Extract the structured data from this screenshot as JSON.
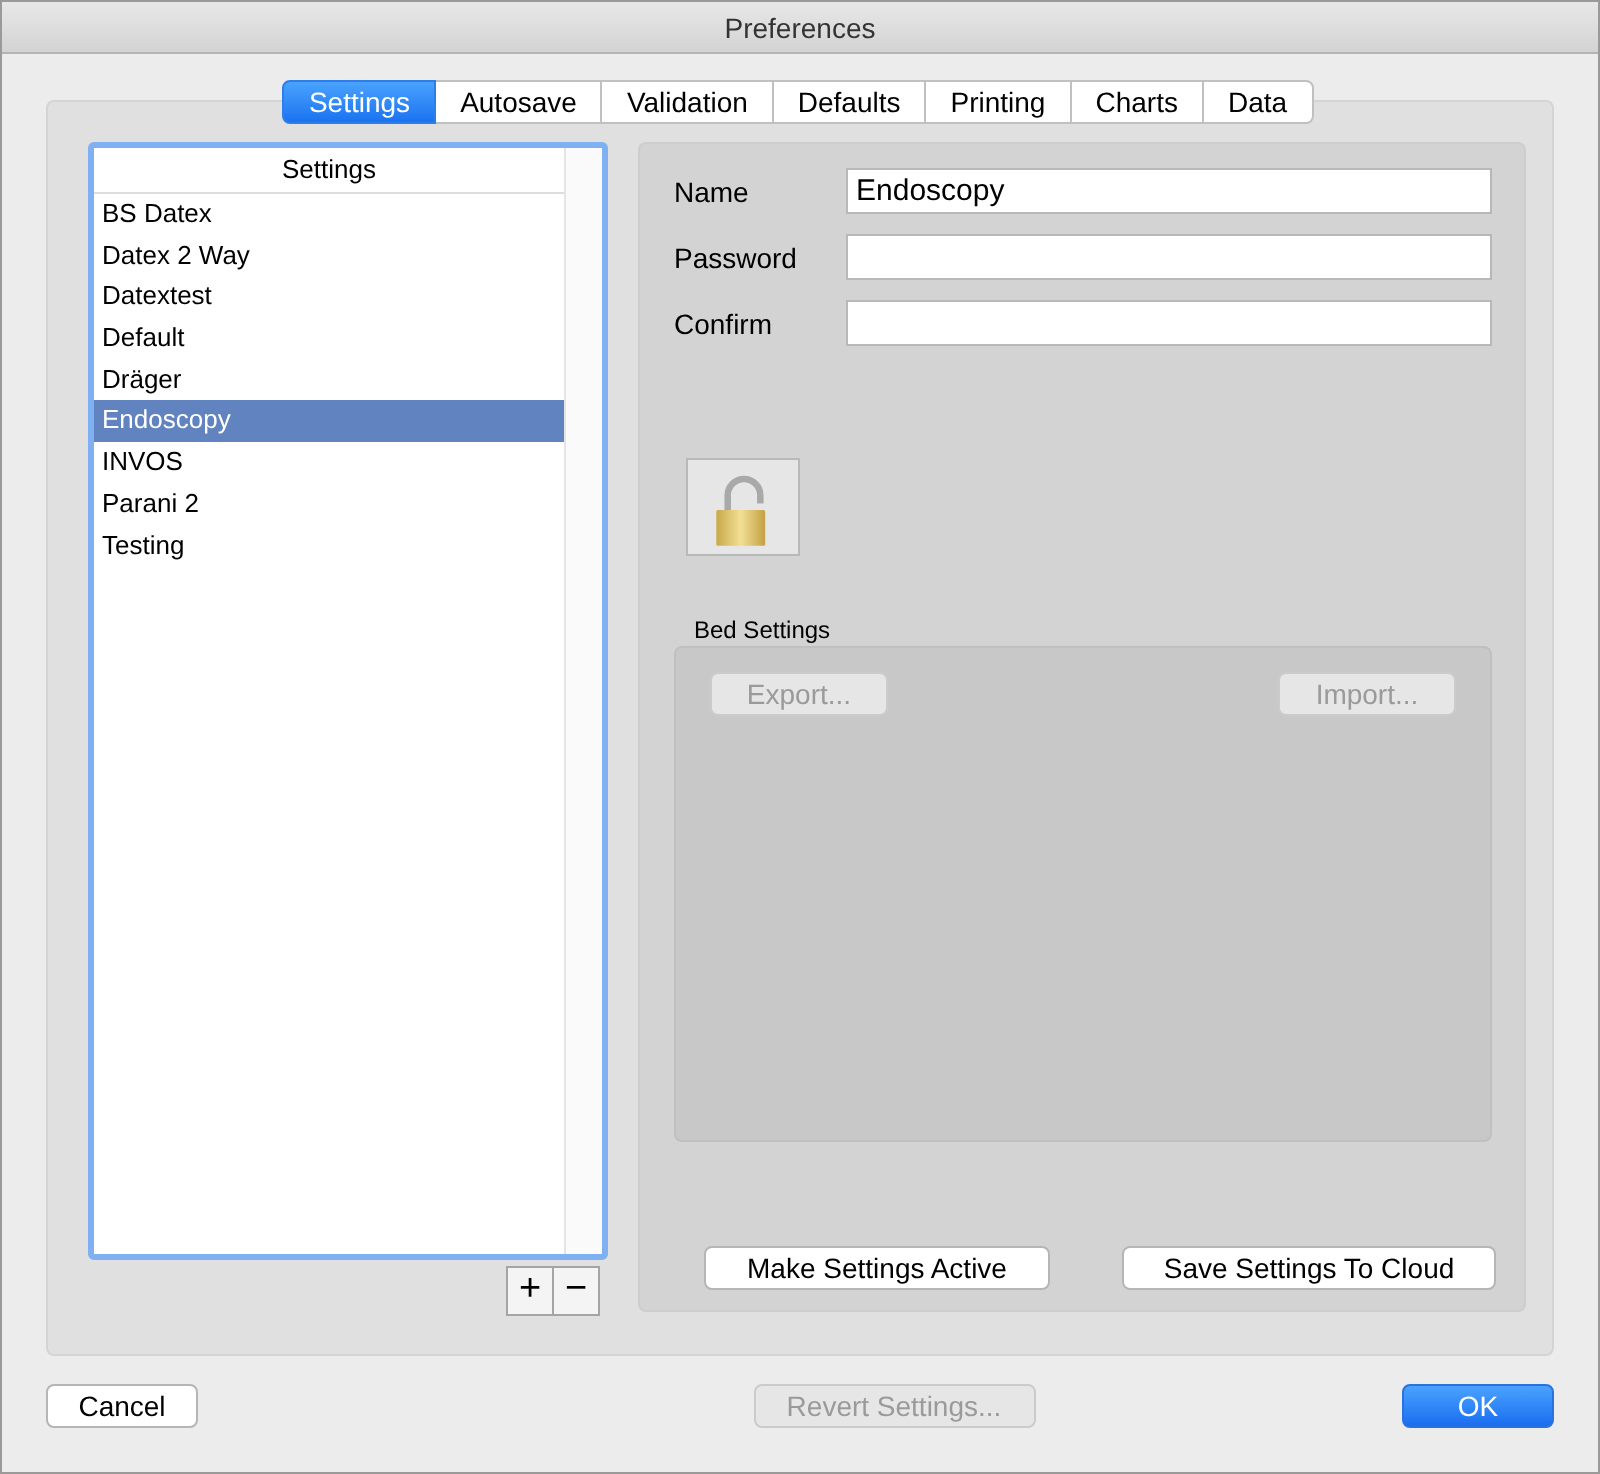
{
  "window": {
    "title": "Preferences"
  },
  "tabs": [
    {
      "label": "Settings",
      "selected": true
    },
    {
      "label": "Autosave",
      "selected": false
    },
    {
      "label": "Validation",
      "selected": false
    },
    {
      "label": "Defaults",
      "selected": false
    },
    {
      "label": "Printing",
      "selected": false
    },
    {
      "label": "Charts",
      "selected": false
    },
    {
      "label": "Data",
      "selected": false
    }
  ],
  "settings_list": {
    "header": "Settings",
    "items": [
      {
        "label": "BS Datex",
        "selected": false
      },
      {
        "label": "Datex 2 Way",
        "selected": false
      },
      {
        "label": "Datextest",
        "selected": false
      },
      {
        "label": "Default",
        "selected": false
      },
      {
        "label": "Dräger",
        "selected": false
      },
      {
        "label": "Endoscopy",
        "selected": true
      },
      {
        "label": "INVOS",
        "selected": false
      },
      {
        "label": "Parani 2",
        "selected": false
      },
      {
        "label": "Testing",
        "selected": false
      }
    ],
    "add": "+",
    "remove": "−"
  },
  "form": {
    "fields": [
      {
        "label": "Name",
        "value": "Endoscopy"
      },
      {
        "label": "Password"
      },
      {
        "label": "Confirm"
      }
    ],
    "locked": false
  },
  "bed_settings": {
    "title": "Bed Settings",
    "buttons": [
      {
        "label": "Export...",
        "disabled": true
      },
      {
        "label": "Import...",
        "disabled": true
      }
    ]
  },
  "panel_buttons": [
    {
      "label": "Make Settings Active",
      "disabled": false
    },
    {
      "label": "Save Settings To Cloud",
      "disabled": false
    }
  ],
  "footer_buttons": [
    {
      "label": "Cancel",
      "disabled": false,
      "default": false
    },
    {
      "label": "Revert Settings...",
      "disabled": true,
      "default": false
    },
    {
      "label": "OK",
      "disabled": false,
      "default": true
    }
  ]
}
